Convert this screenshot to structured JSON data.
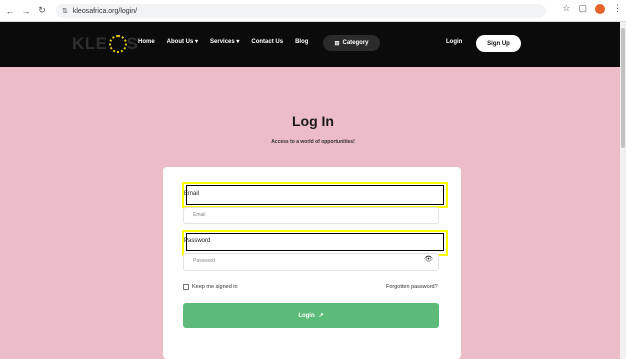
{
  "browser": {
    "back": "←",
    "forward": "→",
    "reload": "↻",
    "site_info": "⇅",
    "url": "kleosafrica.org/login/",
    "star": "☆",
    "ext": "▢",
    "menu": "⋮"
  },
  "header": {
    "logo_left": "KLE",
    "logo_right": "S",
    "menu": [
      "Home",
      "About Us ▾",
      "Services ▾",
      "Contact Us",
      "Blog"
    ],
    "category": "Category",
    "category_icon": "⊞",
    "login": "Login",
    "signup": "Sign Up"
  },
  "main": {
    "title": "Log In",
    "subtitle": "Access to a world of opportunities!",
    "email_label": "Email",
    "email_placeholder": "Email",
    "password_label": "Password",
    "password_placeholder": "Password",
    "eye_icon": "👁",
    "keep_signed_in": "Keep me signed in",
    "forgot_password": "Forgotten password?",
    "login_button": "Login",
    "login_arrow": "↗"
  }
}
